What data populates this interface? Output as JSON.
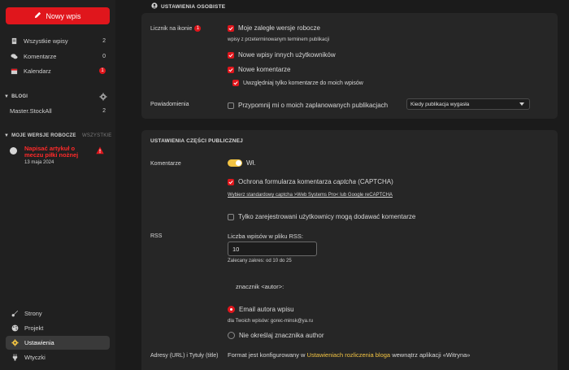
{
  "sidebar": {
    "new_post": "Nowy wpis",
    "nav": [
      {
        "label": "Wszystkie wpisy",
        "count": "2"
      },
      {
        "label": "Komentarze",
        "count": "0"
      },
      {
        "label": "Kalendarz",
        "count": "1"
      }
    ],
    "blogs_header": "BLOGI",
    "blog_item": {
      "label": "Master.StockAll",
      "count": "2"
    },
    "drafts_header": "MOJE WERSJE ROBOCZE",
    "drafts_link": "WSZYSTKIE",
    "draft": {
      "title": "Napisać artykuł o meczu piłki nożnej",
      "date": "13 maja 2024"
    },
    "bottom_nav": [
      {
        "label": "Strony"
      },
      {
        "label": "Projekt"
      },
      {
        "label": "Ustawienia"
      },
      {
        "label": "Wtyczki"
      }
    ]
  },
  "personal": {
    "title": "USTAWIENIA OSOBISTE",
    "counter_label": "Licznik na ikonie",
    "counter_badge": "1",
    "opt1": "Moje zaległe wersje robocze",
    "opt1_hint": "wpisy z przeterminowanym terminem publikacji",
    "opt2": "Nowe wpisy innych użytkowników",
    "opt3": "Nowe komentarze",
    "opt4": "Uwzględniaj tylko komentarze do moich wpisów",
    "notif_label": "Powiadomienia",
    "notif_opt": "Przypomnij mi o moich zaplanowanych publikacjach",
    "notif_select": "Kiedy publikacja wygasła"
  },
  "public": {
    "title": "USTAWIENIA CZĘŚCI PUBLICZNEJ",
    "comments_label": "Komentarze",
    "toggle_text": "Wł.",
    "captcha": "Ochrona formularza komentarza ",
    "captcha_italic": "captcha",
    "captcha_tail": " (CAPTCHA)",
    "captcha_link": "Wybierz standardowy captcha >Web Systems Pro< lub Google reCAPTCHA",
    "registered_only": "Tylko zarejestrowani użytkownicy mogą dodawać komentarze",
    "rss_label": "RSS",
    "rss_count_label": "Liczba wpisów w pliku RSS:",
    "rss_count": "10",
    "rss_range": "Zalecany zakres: od 10 do 25",
    "author_tag": "znacznik <autor>:",
    "author_email": "Email autora wpisu",
    "author_email_hint": "dla Twoich wpisów: gorec-minsk@ya.ru",
    "author_none": "Nie określaj znacznika author",
    "urls_label": "Adresy (URL) i Tytuły (title)",
    "urls_text_pre": "Format jest konfigurowany w ",
    "urls_link": "Ustawieniach rozliczenia bloga",
    "urls_text_post": " wewnątrz aplikacji «Witryna»"
  }
}
